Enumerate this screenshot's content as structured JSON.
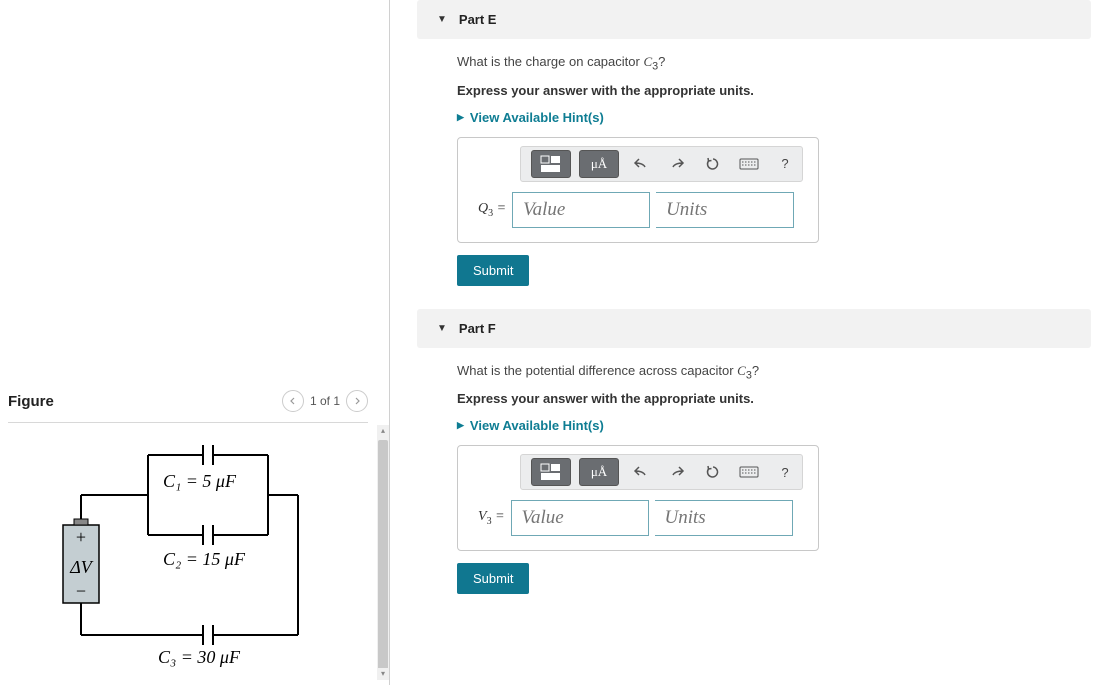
{
  "figure": {
    "title": "Figure",
    "pager_current": "1 of 1",
    "circuit": {
      "battery_label": "ΔV",
      "c1_label": "C₁ = 5 μF",
      "c2_label": "C₂ = 15 μF",
      "c3_label": "C₃ = 30 μF"
    }
  },
  "parts": [
    {
      "id": "E",
      "header": "Part E",
      "question_html": "What is the charge on capacitor C₃?",
      "instruction": "Express your answer with the appropriate units.",
      "hints_label": "View Available Hint(s)",
      "variable_label": "Q₃ =",
      "value_placeholder": "Value",
      "units_placeholder": "Units",
      "submit_label": "Submit"
    },
    {
      "id": "F",
      "header": "Part F",
      "question_html": "What is the potential difference across capacitor C₃?",
      "instruction": "Express your answer with the appropriate units.",
      "hints_label": "View Available Hint(s)",
      "variable_label": "V₃ =",
      "value_placeholder": "Value",
      "units_placeholder": "Units",
      "submit_label": "Submit"
    }
  ],
  "toolbar": {
    "units_btn": "μÅ",
    "help_btn": "?"
  }
}
